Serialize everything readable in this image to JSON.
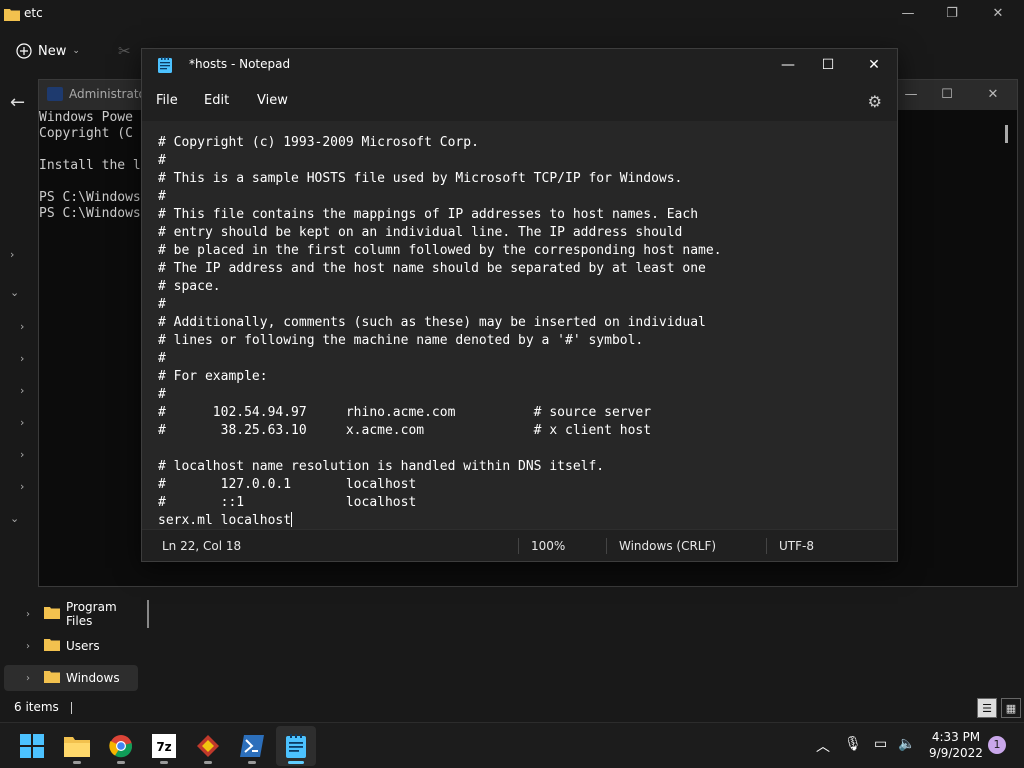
{
  "explorer": {
    "title": "etc",
    "new_label": "New",
    "nav_items": [
      {
        "label": "Program Files"
      },
      {
        "label": "Users"
      },
      {
        "label": "Windows"
      }
    ],
    "status": "6 items"
  },
  "powershell": {
    "title": "Administrator",
    "lines": [
      "Windows Powe",
      "Copyright (C",
      "",
      "Install the l",
      "",
      "PS C:\\Windows",
      "PS C:\\Windows"
    ]
  },
  "notepad": {
    "title": "*hosts - Notepad",
    "menu": {
      "file": "File",
      "edit": "Edit",
      "view": "View"
    },
    "content": "# Copyright (c) 1993-2009 Microsoft Corp.\n#\n# This is a sample HOSTS file used by Microsoft TCP/IP for Windows.\n#\n# This file contains the mappings of IP addresses to host names. Each\n# entry should be kept on an individual line. The IP address should\n# be placed in the first column followed by the corresponding host name.\n# The IP address and the host name should be separated by at least one\n# space.\n#\n# Additionally, comments (such as these) may be inserted on individual\n# lines or following the machine name denoted by a '#' symbol.\n#\n# For example:\n#\n#      102.54.94.97     rhino.acme.com          # source server\n#       38.25.63.10     x.acme.com              # x client host\n\n# localhost name resolution is handled within DNS itself.\n#\t127.0.0.1       localhost\n#\t::1             localhost\nserx.ml localhost",
    "status": {
      "position": "Ln 22, Col 18",
      "zoom": "100%",
      "line_ending": "Windows (CRLF)",
      "encoding": "UTF-8"
    }
  },
  "taskbar": {
    "apps": [
      "start",
      "file-explorer",
      "chrome",
      "7-zip",
      "app",
      "powershell",
      "notepad"
    ],
    "time": "4:33 PM",
    "date": "9/9/2022",
    "notification_count": "1"
  },
  "colors": {
    "accent": "#60cdff",
    "folder": "#f2c14e",
    "notif": "#c9a7ea"
  }
}
